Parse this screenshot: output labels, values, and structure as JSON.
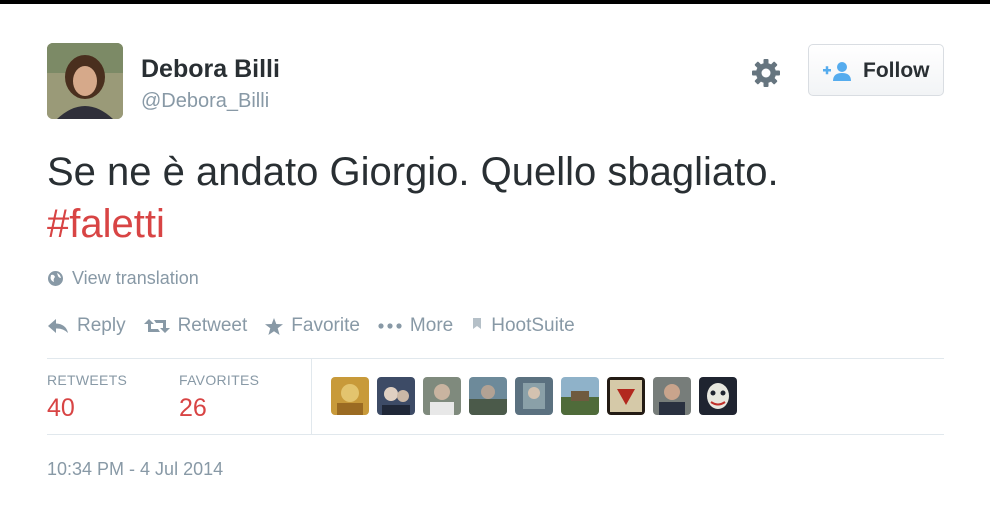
{
  "user": {
    "name": "Debora Billi",
    "handle": "@Debora_Billi"
  },
  "follow_label": "Follow",
  "tweet": {
    "text": "Se ne è andato Giorgio. Quello sbagliato.",
    "hashtag": "#faletti"
  },
  "view_translation": "View translation",
  "actions": {
    "reply": "Reply",
    "retweet": "Retweet",
    "favorite": "Favorite",
    "more": "More",
    "hootsuite": "HootSuite"
  },
  "stats": {
    "retweets_label": "RETWEETS",
    "retweets_value": "40",
    "favorites_label": "FAVORITES",
    "favorites_value": "26"
  },
  "timestamp": "10:34 PM - 4 Jul 2014",
  "colors": {
    "accent_red": "#d84444",
    "muted": "#8899a6",
    "text": "#292f33"
  }
}
